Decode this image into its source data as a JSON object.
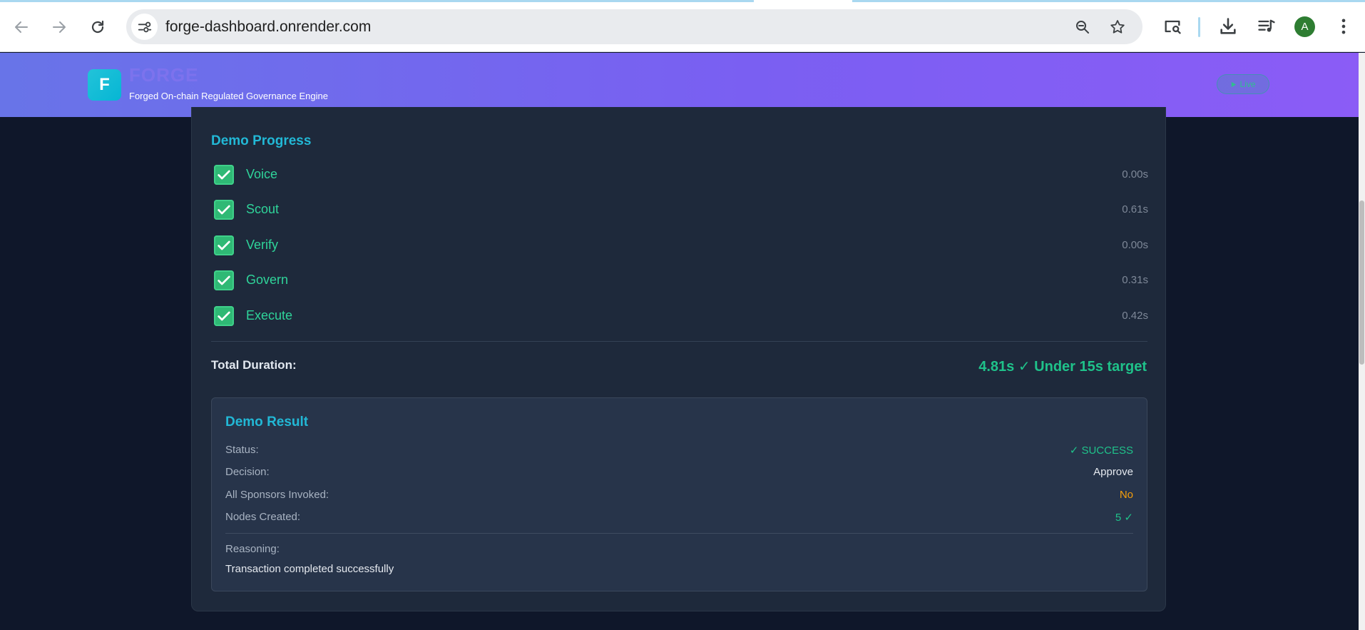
{
  "browser": {
    "url": "forge-dashboard.onrender.com",
    "profile_initial": "A",
    "icons": [
      "back-icon",
      "forward-icon",
      "reload-icon",
      "site-info-icon",
      "zoom-icon",
      "bookmark-star-icon",
      "search-tab-icon",
      "download-icon",
      "media-control-icon",
      "more-menu-icon"
    ]
  },
  "header": {
    "logo_letter": "F",
    "title": "FORGE",
    "subtitle": "Forged On-chain Regulated Governance Engine",
    "live_label": "Live"
  },
  "progress": {
    "title": "Demo Progress",
    "steps": [
      {
        "label": "Voice",
        "time": "0.00s",
        "done": true
      },
      {
        "label": "Scout",
        "time": "0.61s",
        "done": true
      },
      {
        "label": "Verify",
        "time": "0.00s",
        "done": true
      },
      {
        "label": "Govern",
        "time": "0.31s",
        "done": true
      },
      {
        "label": "Execute",
        "time": "0.42s",
        "done": true
      }
    ],
    "total_label": "Total Duration:",
    "total_value": "4.81s ✓ Under 15s target"
  },
  "result": {
    "title": "Demo Result",
    "status_label": "Status:",
    "status_value": "✓ SUCCESS",
    "decision_label": "Decision:",
    "decision_value": "Approve",
    "sponsors_label": "All Sponsors Invoked:",
    "sponsors_value": "No",
    "nodes_label": "Nodes Created:",
    "nodes_value": "5 ✓",
    "reasoning_label": "Reasoning:",
    "reasoning_text": "Transaction completed successfully"
  },
  "colors": {
    "accent_cyan": "#22b8d6",
    "success_green": "#1fc28a",
    "warning_orange": "#f59e0b",
    "page_bg": "#0f172a",
    "card_bg": "#1e293b"
  }
}
